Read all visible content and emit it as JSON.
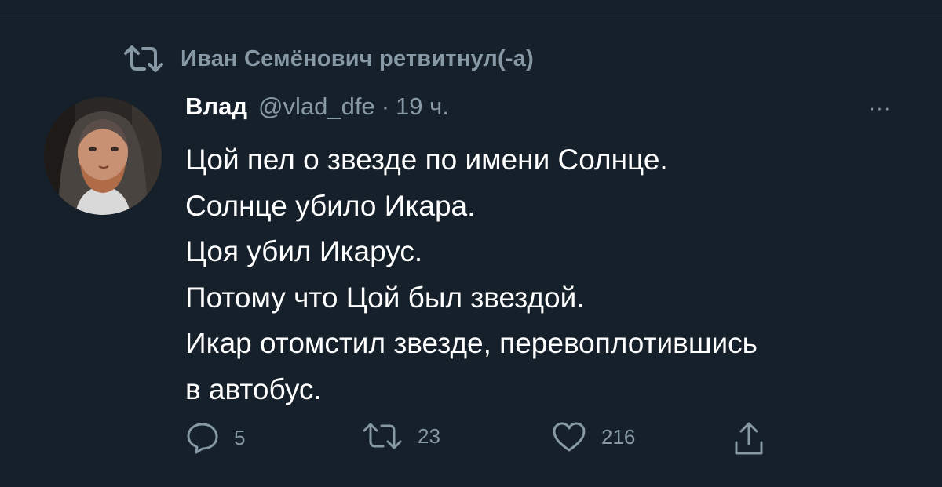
{
  "retweet_context": {
    "icon": "retweet-icon",
    "text": "Иван Семёнович ретвитнул(-а)"
  },
  "tweet": {
    "author": {
      "display_name": "Влад",
      "handle": "@vlad_dfe",
      "separator": "·",
      "time": "19 ч.",
      "avatar": "avatar-photo"
    },
    "more_icon": "more-horizontal-icon",
    "more_label": "···",
    "lines": [
      "Цой пел о звезде по имени Солнце.",
      "Солнце убило Икара.",
      "Цоя убил Икарус.",
      "Потому что Цой был звездой.",
      "Икар отомстил звезде, перевоплотившись",
      "в автобус."
    ],
    "actions": {
      "reply": {
        "icon": "reply-icon",
        "count": "5"
      },
      "retweet": {
        "icon": "retweet-icon",
        "count": "23"
      },
      "like": {
        "icon": "heart-icon",
        "count": "216"
      },
      "share": {
        "icon": "share-icon"
      }
    }
  },
  "colors": {
    "background": "#15202b",
    "text_primary": "#ffffff",
    "text_secondary": "#8899a6",
    "divider": "#38444d"
  }
}
